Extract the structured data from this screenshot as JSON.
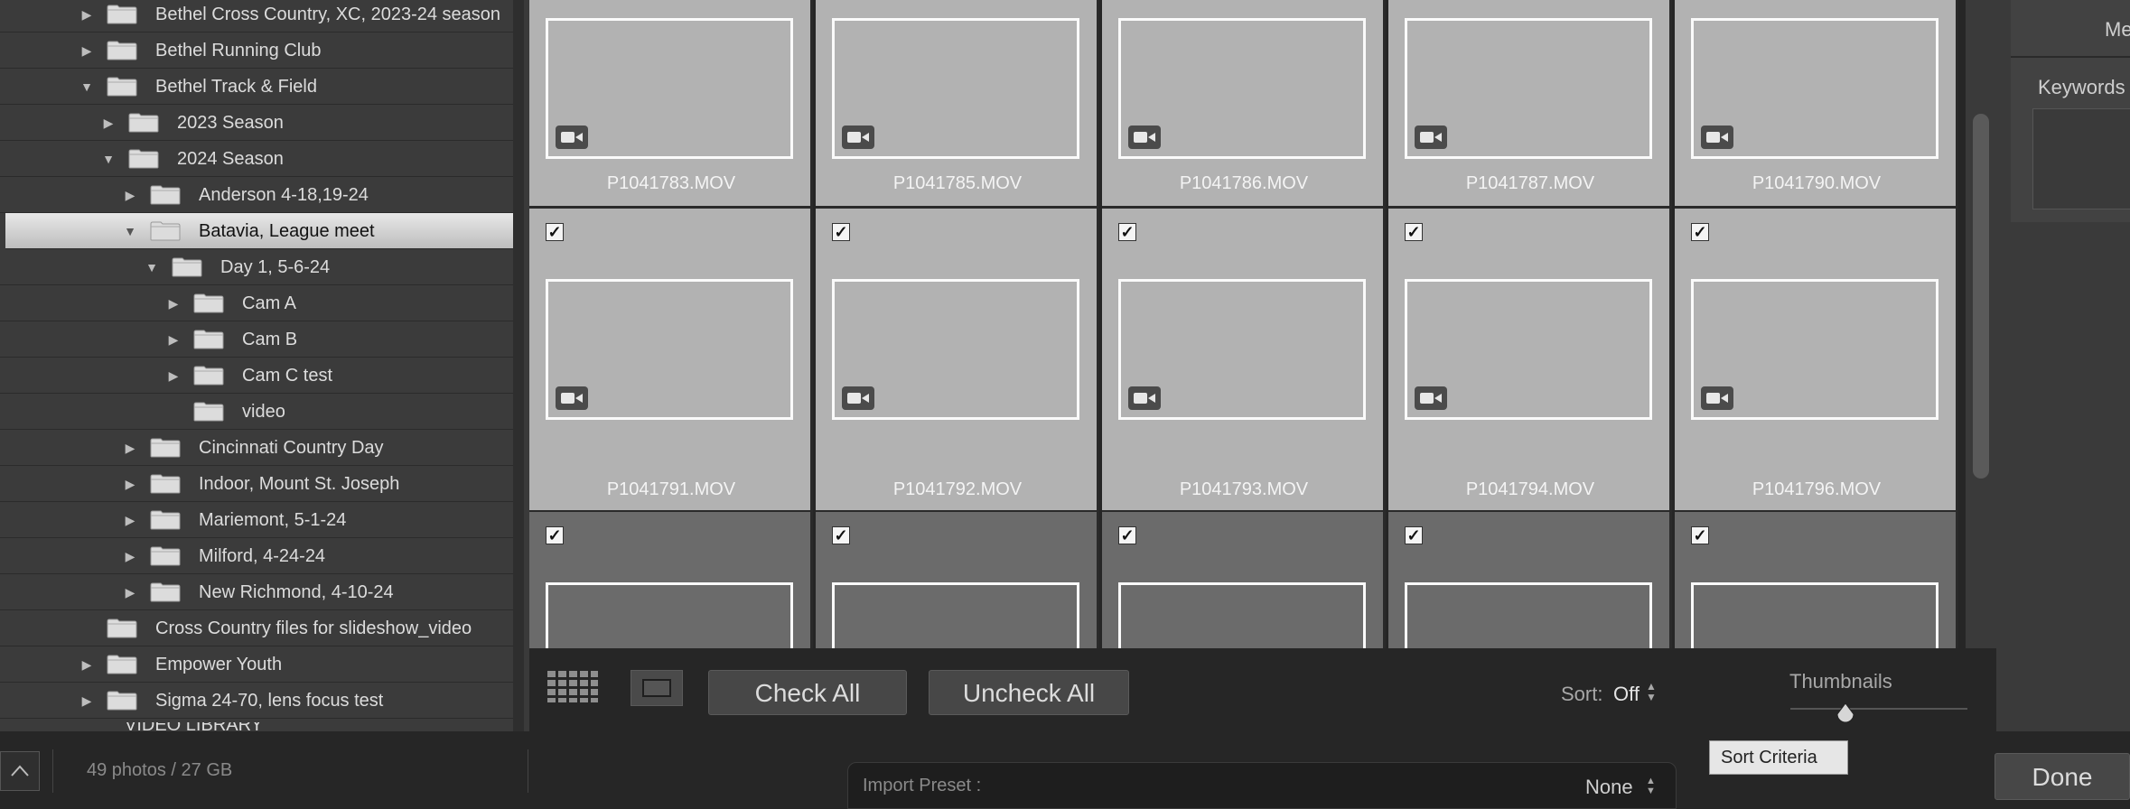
{
  "folder_tree": [
    {
      "label": "Bethel Cross Country, XC, 2023-24 season",
      "level": 0,
      "expander": "collapsed"
    },
    {
      "label": "Bethel Running Club",
      "level": 0,
      "expander": "collapsed"
    },
    {
      "label": "Bethel Track & Field",
      "level": 0,
      "expander": "expanded"
    },
    {
      "label": "2023 Season",
      "level": 1,
      "expander": "collapsed"
    },
    {
      "label": "2024 Season",
      "level": 1,
      "expander": "expanded"
    },
    {
      "label": "Anderson 4-18,19-24",
      "level": 2,
      "expander": "collapsed"
    },
    {
      "label": "Batavia, League meet",
      "level": 2,
      "expander": "expanded",
      "selected": true
    },
    {
      "label": "Day 1, 5-6-24",
      "level": 3,
      "expander": "expanded"
    },
    {
      "label": "Cam A",
      "level": 4,
      "expander": "collapsed"
    },
    {
      "label": "Cam B",
      "level": 4,
      "expander": "collapsed"
    },
    {
      "label": "Cam C test",
      "level": 4,
      "expander": "collapsed"
    },
    {
      "label": "video",
      "level": 4,
      "expander": "none"
    },
    {
      "label": "Cincinnati Country Day",
      "level": 2,
      "expander": "collapsed"
    },
    {
      "label": "Indoor, Mount St. Joseph",
      "level": 2,
      "expander": "collapsed"
    },
    {
      "label": "Mariemont, 5-1-24",
      "level": 2,
      "expander": "collapsed"
    },
    {
      "label": "Milford, 4-24-24",
      "level": 2,
      "expander": "collapsed"
    },
    {
      "label": "New Richmond, 4-10-24",
      "level": 2,
      "expander": "collapsed"
    },
    {
      "label": "Cross Country files for slideshow_video",
      "level": 0,
      "expander": "none"
    },
    {
      "label": "Empower Youth",
      "level": 0,
      "expander": "collapsed"
    },
    {
      "label": "Sigma 24-70, lens focus test",
      "level": 0,
      "expander": "collapsed"
    }
  ],
  "grid": {
    "rows": [
      {
        "checked": false,
        "items": [
          {
            "name": "P1041783.MOV",
            "scene": "field-day",
            "video": true
          },
          {
            "name": "P1041785.MOV",
            "scene": "pit-day",
            "video": true
          },
          {
            "name": "P1041786.MOV",
            "scene": "pit-day",
            "video": true
          },
          {
            "name": "P1041787.MOV",
            "scene": "pit-day",
            "video": true
          },
          {
            "name": "P1041790.MOV",
            "scene": "crowd-day",
            "video": true
          }
        ]
      },
      {
        "checked": true,
        "items": [
          {
            "name": "P1041791.MOV",
            "scene": "legs",
            "video": true
          },
          {
            "name": "P1041792.MOV",
            "scene": "grass-dark",
            "video": true
          },
          {
            "name": "P1041793.MOV",
            "scene": "group",
            "video": true
          },
          {
            "name": "P1041794.MOV",
            "scene": "polevault",
            "video": true
          },
          {
            "name": "P1041796.MOV",
            "scene": "lights-field",
            "video": true
          }
        ]
      },
      {
        "checked": true,
        "items": [
          {
            "name": "",
            "scene": "stadium-night",
            "video": true
          },
          {
            "name": "",
            "scene": "boy-night",
            "video": true
          },
          {
            "name": "",
            "scene": "grass-close",
            "video": true
          },
          {
            "name": "",
            "scene": "bokeh",
            "video": true
          },
          {
            "name": "",
            "scene": "runner-night",
            "video": true
          }
        ]
      }
    ]
  },
  "toolbar": {
    "check_all": "Check All",
    "uncheck_all": "Uncheck All",
    "sort_label": "Sort:",
    "sort_value": "Off",
    "thumbnails_label": "Thumbnails",
    "thumbnail_size": 0.31
  },
  "tooltip": "Sort Criteria",
  "right_panel": {
    "metadata_label": "Metadata",
    "metadata_visible": "Metł",
    "keywords_label": "Keywords"
  },
  "bottom": {
    "photo_count": "49 photos / 27 GB",
    "import_preset_label": "Import Preset :",
    "import_preset_value": "None",
    "done": "Done",
    "partial_folder": "VIDEO LIBRARY"
  },
  "colors": {
    "selection": "#d6d6d6",
    "cell_checked": "#b2b2b2",
    "cell_unchecked": "#6b6b6b"
  }
}
